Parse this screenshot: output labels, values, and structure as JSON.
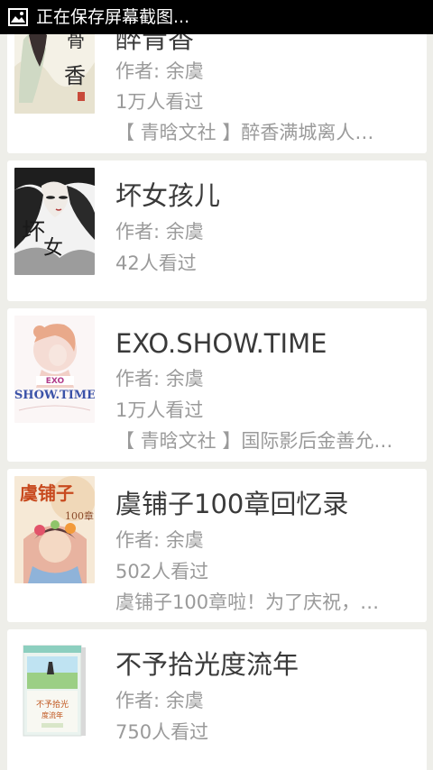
{
  "status_bar": {
    "text": "正在保存屏幕截图...",
    "icon": "image-icon"
  },
  "books": [
    {
      "title": "醉青香",
      "author": "作者: 余虞",
      "views": "1万人看过",
      "desc": "【 青晗文社 】醉香满城离人…",
      "cover_icon": "cover-zuiqingxiang"
    },
    {
      "title": "坏女孩儿",
      "author": "作者: 余虞",
      "views": "42人看过",
      "desc": "",
      "cover_icon": "cover-huainvhaier"
    },
    {
      "title": "EXO.SHOW.TIME",
      "author": "作者: 余虞",
      "views": "1万人看过",
      "desc": "【 青晗文社 】国际影后金善允…",
      "cover_icon": "cover-exo-show-time",
      "cover_text": "SHOW.TIME"
    },
    {
      "title": "虞铺子100章回忆录",
      "author": "作者: 余虞",
      "views": "502人看过",
      "desc": "虞铺子100章啦！为了庆祝，…",
      "cover_icon": "cover-yupuzi",
      "cover_text": "虞铺子",
      "cover_subtext": "100章"
    },
    {
      "title": "不予拾光度流年",
      "author": "作者: 余虞",
      "views": "750人看过",
      "desc": "",
      "cover_icon": "cover-buyushiguang"
    }
  ]
}
